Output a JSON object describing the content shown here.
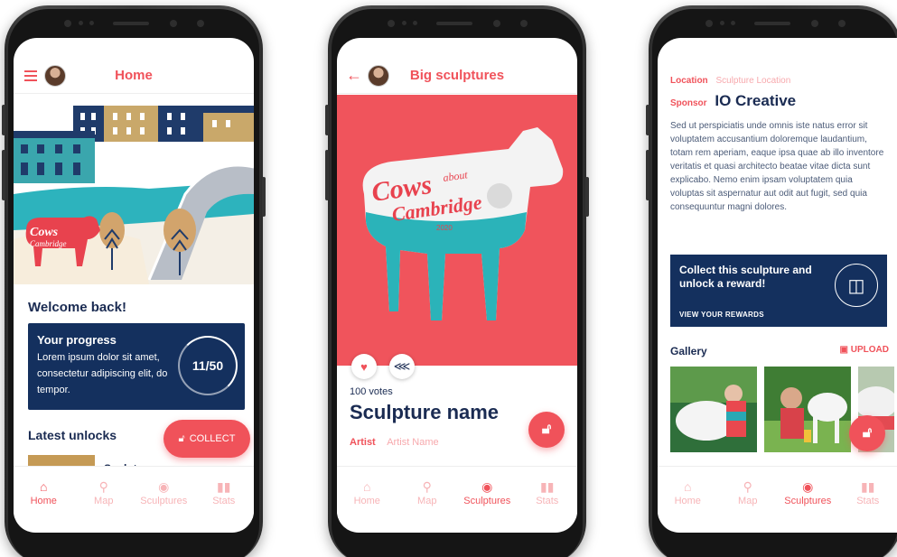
{
  "screen1": {
    "title": "Home",
    "welcome": "Welcome back!",
    "progress_title": "Your progress",
    "progress_text": "Lorem ipsum dolor sit amet, consectetur adipiscing elit, do tempor.",
    "progress_count": "11/50",
    "latest_unlocks": "Latest unlocks",
    "collect_label": "COLLECT",
    "sculpture_peek": "Sculpture name"
  },
  "screen2": {
    "title": "Big sculptures",
    "votes": "100 votes",
    "sculpture_name": "Sculpture name",
    "artist_label": "Artist",
    "artist_value": "Artist Name"
  },
  "screen3": {
    "location_label": "Location",
    "location_value": "Sculpture Location",
    "sponsor_label": "Sponsor",
    "sponsor_value": "IO Creative",
    "description": "Sed ut perspiciatis unde omnis iste natus error sit voluptatem accusantium doloremque laudantium, totam rem aperiam, eaque ipsa quae ab illo inventore veritatis et quasi architecto beatae vitae dicta sunt explicabo. Nemo enim ipsam voluptatem quia voluptas sit aspernatur aut odit aut fugit, sed quia consequuntur magni dolores.",
    "reward_title": "Collect this sculpture and unlock a reward!",
    "reward_link": "VIEW YOUR REWARDS",
    "gallery": "Gallery",
    "upload": "UPLOAD"
  },
  "illustration": {
    "cow_text_1": "Cows",
    "cow_text_2": "about",
    "cow_text_3": "Cambridge",
    "cow_text_4": "2020"
  },
  "nav": {
    "home": "Home",
    "map": "Map",
    "sculptures": "Sculptures",
    "stats": "Stats"
  },
  "colors": {
    "accent": "#f0525a",
    "navy": "#14305e"
  }
}
